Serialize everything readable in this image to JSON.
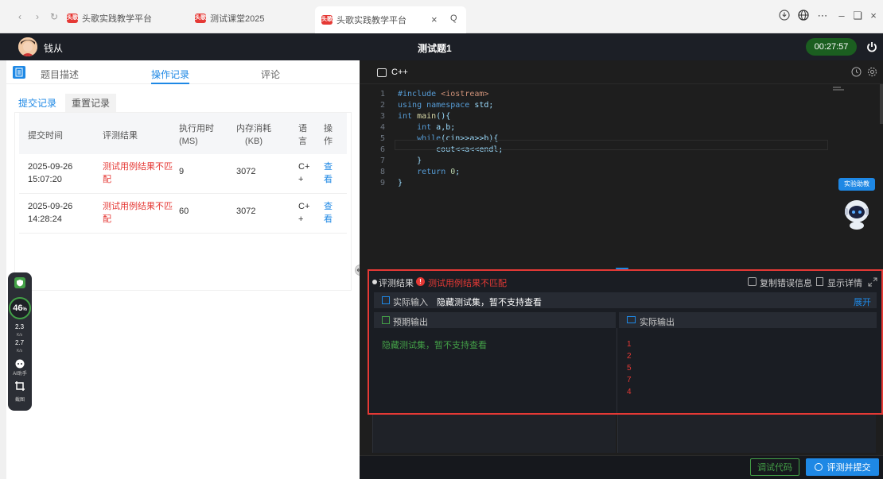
{
  "browser": {
    "tabs": [
      {
        "label": "头歌实践教学平台",
        "favicon": "头歌"
      },
      {
        "label": "测试课堂2025",
        "favicon": "头歌"
      },
      {
        "label": "头歌实践教学平台",
        "favicon": "头歌"
      }
    ],
    "close_label": "×",
    "search_label": "Q"
  },
  "header": {
    "user_name": "钱从",
    "title": "测试题1",
    "timer": "00:27:57"
  },
  "left": {
    "tabs": [
      "题目描述",
      "操作记录",
      "评论"
    ],
    "subtabs": [
      "提交记录",
      "重置记录"
    ],
    "columns": [
      "提交时间",
      "评测结果",
      "执行用时\n(MS)",
      "内存消耗\n(KB)",
      "语\n言",
      "操\n作"
    ],
    "rows": [
      {
        "time": "2025-09-26\n15:07:20",
        "result": "测试用例结果不匹\n配",
        "exec": "9",
        "mem": "3072",
        "lang": "C+\n+",
        "action": "查\n看"
      },
      {
        "time": "2025-09-26\n14:28:24",
        "result": "测试用例结果不匹\n配",
        "exec": "60",
        "mem": "3072",
        "lang": "C+\n+",
        "action": "查\n看"
      }
    ]
  },
  "widget": {
    "percent": "46",
    "percent_unit": "%",
    "up": "2.3",
    "up_unit": "K/s",
    "down": "2.7",
    "down_unit": "K/s",
    "ai_label": "AI助手",
    "shot_label": "截图"
  },
  "editor": {
    "lang": "C++",
    "lines": [
      {
        "n": "1",
        "html": "<span class=\"kw\">#include</span> <span class=\"str\">&lt;iostream&gt;</span>"
      },
      {
        "n": "2",
        "html": "<span class=\"kw\">using namespace</span> std;"
      },
      {
        "n": "3",
        "html": "<span class=\"kw\">int</span> <span class=\"fn\">main</span>(){"
      },
      {
        "n": "4",
        "html": "    <span class=\"kw\">int</span> a,b;"
      },
      {
        "n": "5",
        "html": "    <span class=\"kw\">while</span>(cin&gt;&gt;a&gt;&gt;b){"
      },
      {
        "n": "6",
        "html": "        cout&lt;&lt;a&lt;&lt;endl;"
      },
      {
        "n": "7",
        "html": "    }"
      },
      {
        "n": "8",
        "html": "    <span class=\"kw\">return</span> <span class=\"num\">0</span>;"
      },
      {
        "n": "9",
        "html": "}"
      }
    ],
    "assistant_label": "实验助教"
  },
  "result": {
    "title": "评测结果",
    "status": "测试用例结果不匹配",
    "copy_label": "复制错误信息",
    "detail_label": "显示详情",
    "input_label": "实际输入",
    "input_value": "隐藏测试集，暂不支持查看",
    "expand_label": "展开",
    "expected_label": "预期输出",
    "expected_value": "隐藏测试集，暂不支持查看",
    "actual_label": "实际输出",
    "actual_values": [
      "1",
      "2",
      "5",
      "7",
      "4"
    ]
  },
  "footer": {
    "debug_label": "调试代码",
    "submit_label": "评测并提交"
  },
  "colors": {
    "accent_blue": "#1e88e5",
    "error_red": "#e53935",
    "success_green": "#2e7d32"
  }
}
